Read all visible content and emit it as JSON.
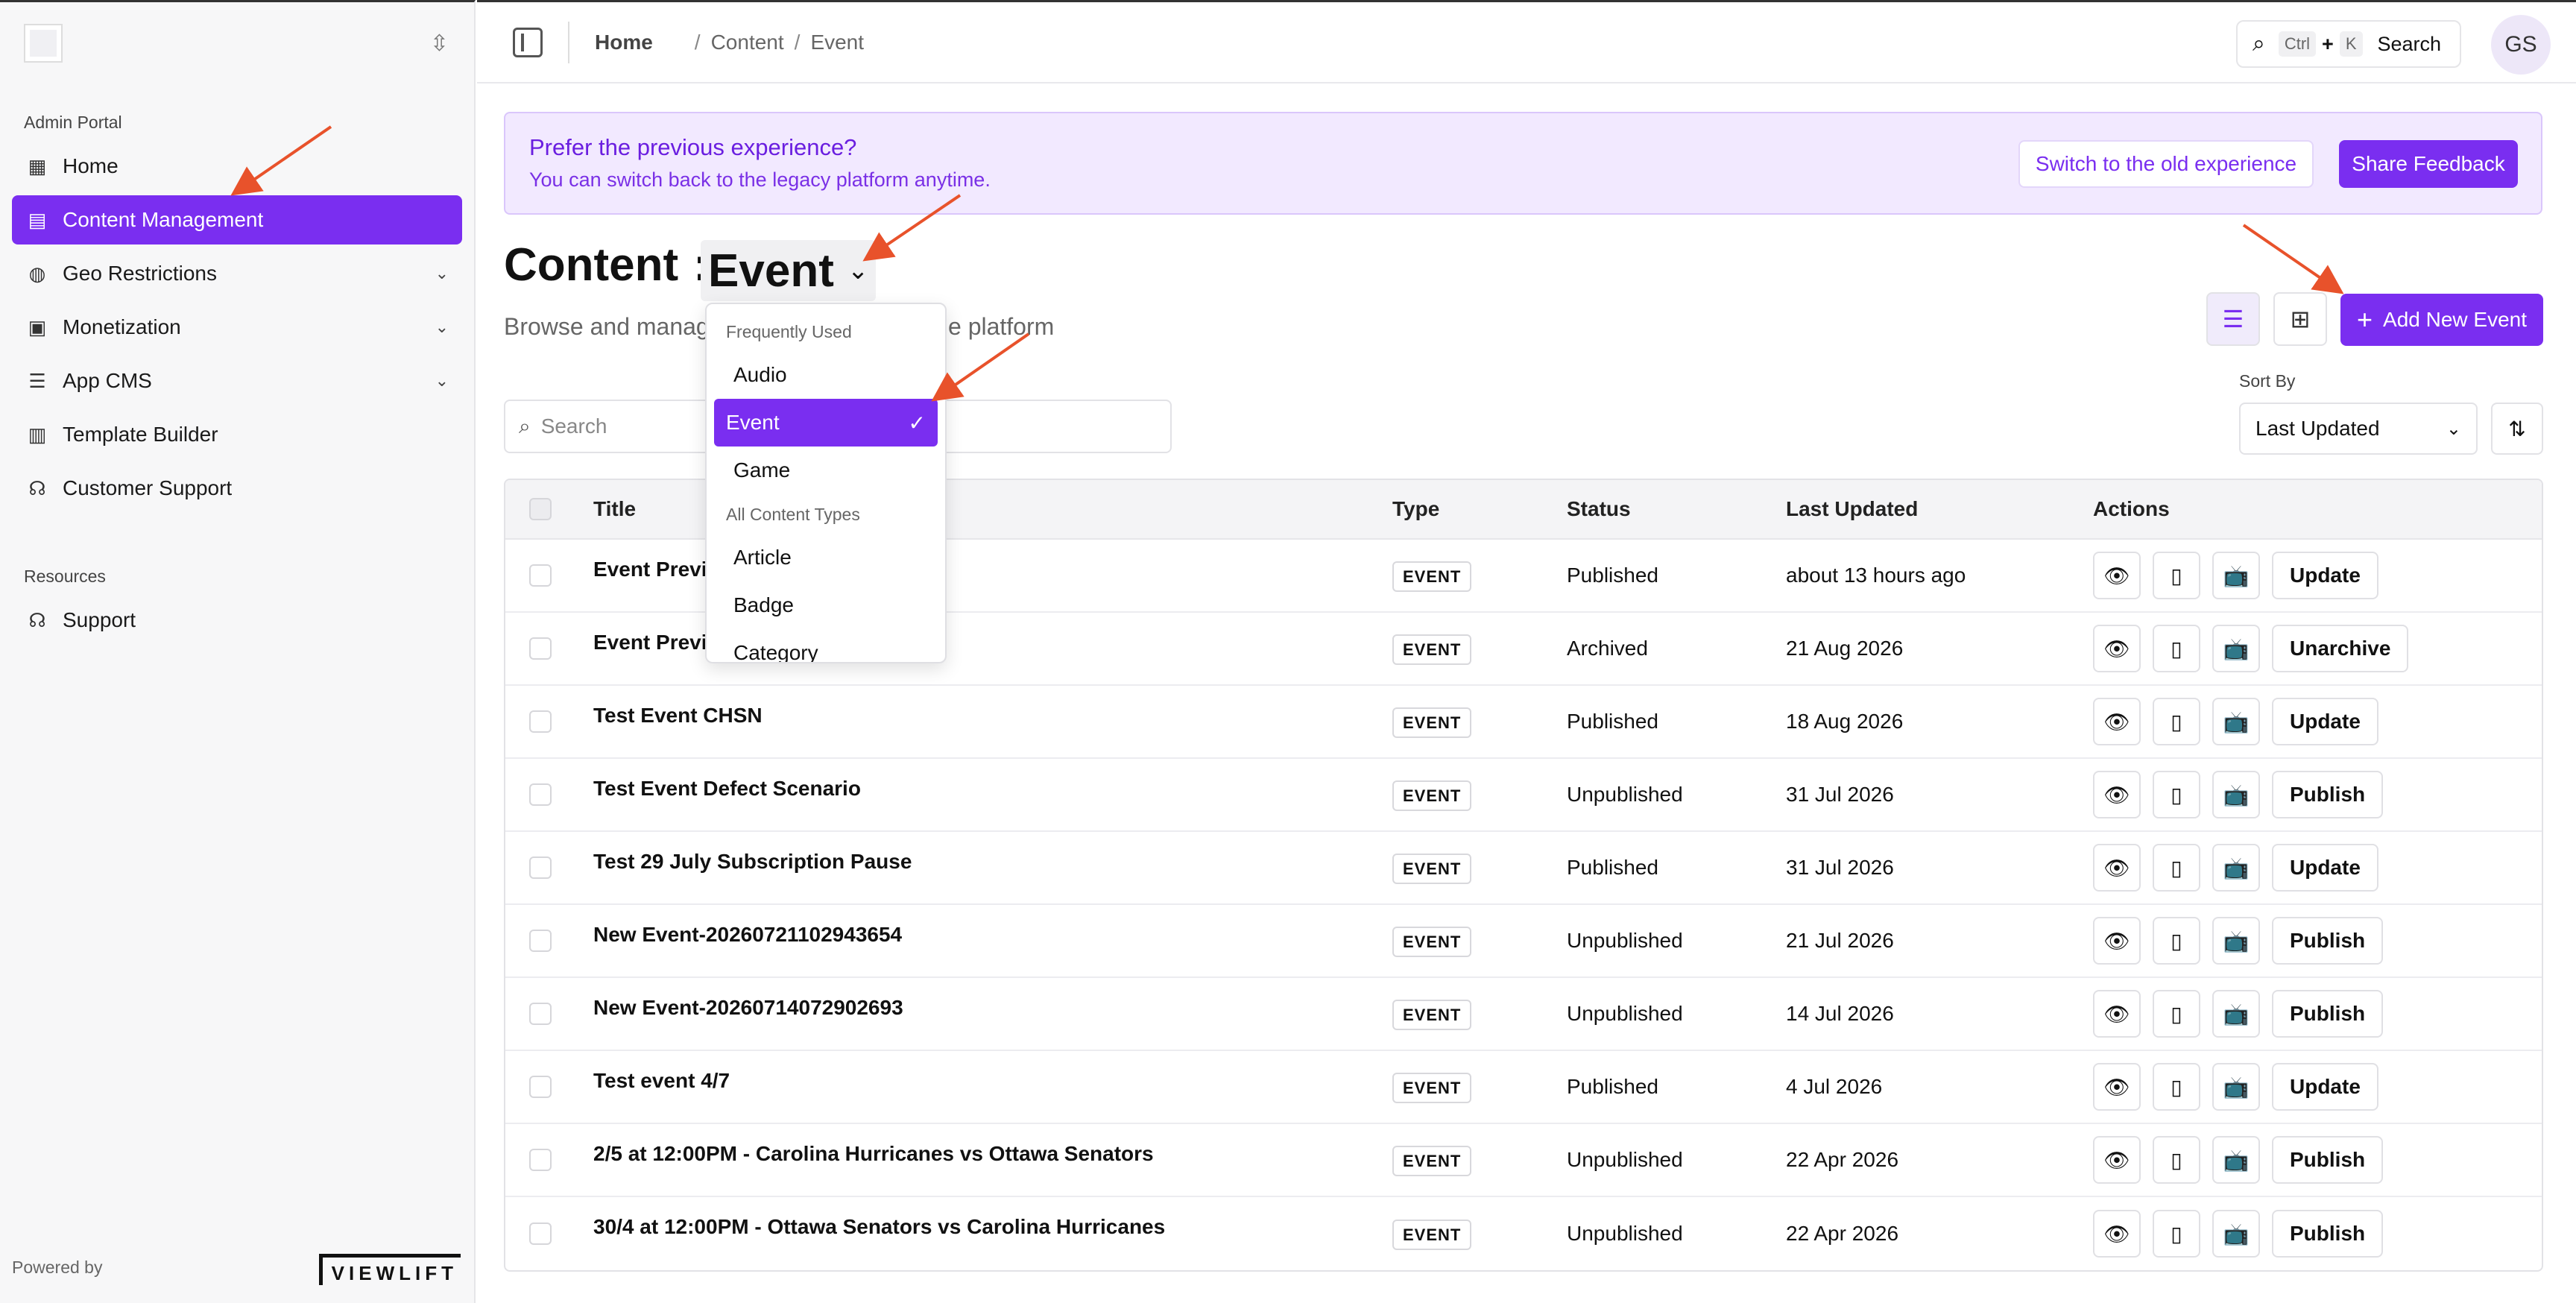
{
  "sidebar": {
    "section_admin": "Admin Portal",
    "items": [
      {
        "label": "Home",
        "icon": "dashboard-icon",
        "glyph": "▦"
      },
      {
        "label": "Content Management",
        "icon": "film-icon",
        "glyph": "▤"
      },
      {
        "label": "Geo Restrictions",
        "icon": "globe-icon",
        "glyph": "◍"
      },
      {
        "label": "Monetization",
        "icon": "wallet-icon",
        "glyph": "▣"
      },
      {
        "label": "App CMS",
        "icon": "sliders-icon",
        "glyph": "☰"
      },
      {
        "label": "Template Builder",
        "icon": "layout-icon",
        "glyph": "▥"
      },
      {
        "label": "Customer Support",
        "icon": "headset-icon",
        "glyph": "☊"
      }
    ],
    "section_resources": "Resources",
    "support_label": "Support",
    "powered_by": "Powered by",
    "brand": "VIEWLIFT"
  },
  "topbar": {
    "breadcrumb": [
      "Home",
      "Content",
      "Event"
    ],
    "search_kbd1": "Ctrl",
    "search_plus": "+",
    "search_kbd2": "K",
    "search_label": "Search",
    "avatar_initials": "GS"
  },
  "banner": {
    "title": "Prefer the previous experience?",
    "subtitle": "You can switch back to the legacy platform anytime.",
    "switch_label": "Switch to the old experience",
    "feedback_label": "Share Feedback"
  },
  "page": {
    "title_prefix": "Content",
    "title_colon": ":",
    "selected_type": "Event",
    "subtitle_a": "Browse and manag",
    "subtitle_b": "e platform",
    "add_label": "Add New Event",
    "search_placeholder": "Search",
    "sort_label": "Sort By",
    "sort_value": "Last Updated"
  },
  "dropdown": {
    "group1": "Frequently Used",
    "frequent": [
      "Audio",
      "Event",
      "Game"
    ],
    "group2": "All Content Types",
    "all": [
      "Article",
      "Badge",
      "Category"
    ]
  },
  "table": {
    "headers": {
      "title": "Title",
      "type": "Type",
      "status": "Status",
      "updated": "Last Updated",
      "actions": "Actions"
    },
    "rows": [
      {
        "title": "Event Previe",
        "type": "EVENT",
        "status": "Published",
        "updated": "about 13 hours ago",
        "action": "Update"
      },
      {
        "title": "Event Previe",
        "type": "EVENT",
        "status": "Archived",
        "updated": "21 Aug 2026",
        "action": "Unarchive"
      },
      {
        "title": "Test Event CHSN",
        "type": "EVENT",
        "status": "Published",
        "updated": "18 Aug 2026",
        "action": "Update"
      },
      {
        "title": "Test Event Defect Scenario",
        "type": "EVENT",
        "status": "Unpublished",
        "updated": "31 Jul 2026",
        "action": "Publish"
      },
      {
        "title": "Test 29 July Subscription Pause",
        "type": "EVENT",
        "status": "Published",
        "updated": "31 Jul 2026",
        "action": "Update"
      },
      {
        "title": "New Event-20260721102943654",
        "type": "EVENT",
        "status": "Unpublished",
        "updated": "21 Jul 2026",
        "action": "Publish"
      },
      {
        "title": "New Event-20260714072902693",
        "type": "EVENT",
        "status": "Unpublished",
        "updated": "14 Jul 2026",
        "action": "Publish"
      },
      {
        "title": "Test event 4/7",
        "type": "EVENT",
        "status": "Published",
        "updated": "4 Jul 2026",
        "action": "Update"
      },
      {
        "title": "2/5 at 12:00PM - Carolina Hurricanes vs Ottawa Senators",
        "type": "EVENT",
        "status": "Unpublished",
        "updated": "22 Apr 2026",
        "action": "Publish"
      },
      {
        "title": "30/4 at 12:00PM - Ottawa Senators vs Carolina Hurricanes",
        "type": "EVENT",
        "status": "Unpublished",
        "updated": "22 Apr 2026",
        "action": "Publish"
      }
    ]
  },
  "colors": {
    "accent": "#7a2ef0",
    "banner_bg": "#f2e9ff",
    "annotation_arrow": "#e8522b"
  }
}
